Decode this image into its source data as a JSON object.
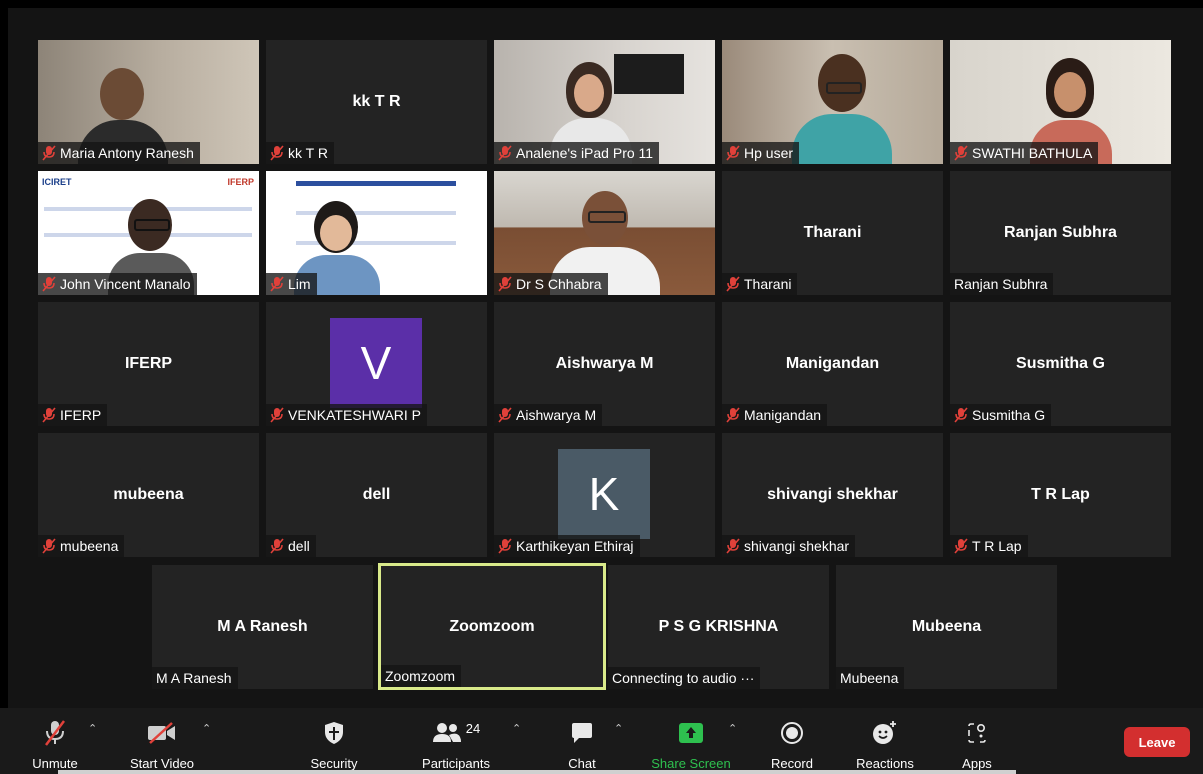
{
  "gallery": {
    "tiles": [
      {
        "center": "",
        "label": "Maria Antony Ranesh",
        "muted": true
      },
      {
        "center": "kk T R",
        "label": "kk T R",
        "muted": true
      },
      {
        "center": "",
        "label": "Analene's iPad Pro 11",
        "muted": true
      },
      {
        "center": "",
        "label": "Hp user",
        "muted": true
      },
      {
        "center": "",
        "label": "SWATHI BATHULA",
        "muted": true
      },
      {
        "center": "",
        "label": "John Vincent Manalo",
        "muted": true
      },
      {
        "center": "",
        "label": "Lim",
        "muted": true
      },
      {
        "center": "",
        "label": "Dr S Chhabra",
        "muted": true
      },
      {
        "center": "Tharani",
        "label": "Tharani",
        "muted": true
      },
      {
        "center": "Ranjan Subhra",
        "label": "Ranjan Subhra",
        "muted": false
      },
      {
        "center": "IFERP",
        "label": "IFERP",
        "muted": true
      },
      {
        "center": "V",
        "label": "VENKATESHWARI P",
        "muted": true,
        "avatar_color": "#5b2fa8"
      },
      {
        "center": "Aishwarya M",
        "label": "Aishwarya M",
        "muted": true
      },
      {
        "center": "Manigandan",
        "label": "Manigandan",
        "muted": true
      },
      {
        "center": "Susmitha G",
        "label": "Susmitha G",
        "muted": true
      },
      {
        "center": "mubeena",
        "label": "mubeena",
        "muted": true
      },
      {
        "center": "dell",
        "label": "dell",
        "muted": true
      },
      {
        "center": "K",
        "label": "Karthikeyan Ethiraj",
        "muted": true,
        "avatar_color": "#4a5a66"
      },
      {
        "center": "shivangi shekhar",
        "label": "shivangi shekhar",
        "muted": true
      },
      {
        "center": "T R Lap",
        "label": "T R Lap",
        "muted": true
      },
      {
        "center": "M A Ranesh",
        "label": "M A Ranesh",
        "muted": false
      },
      {
        "center": "Zoomzoom",
        "label": "Zoomzoom",
        "muted": false,
        "active": true
      },
      {
        "center": "P S G KRISHNA",
        "label": "Connecting to audio ···",
        "muted": false
      },
      {
        "center": "Mubeena",
        "label": "Mubeena",
        "muted": false
      }
    ],
    "banner_text_1": "ICIRET",
    "banner_text_2": "2nd International Conference on Innovative Research in Engineering and Technology",
    "banner_text_3": "IFERP"
  },
  "toolbar": {
    "unmute": "Unmute",
    "start_video": "Start Video",
    "security": "Security",
    "participants": "Participants",
    "participants_count": "24",
    "chat": "Chat",
    "share_screen": "Share Screen",
    "record": "Record",
    "reactions": "Reactions",
    "apps": "Apps",
    "leave": "Leave"
  },
  "colors": {
    "share_green": "#2ec04f",
    "leave_red": "#d32f2f",
    "active_border": "#d9ea8a",
    "muted_red": "#e0413a"
  }
}
